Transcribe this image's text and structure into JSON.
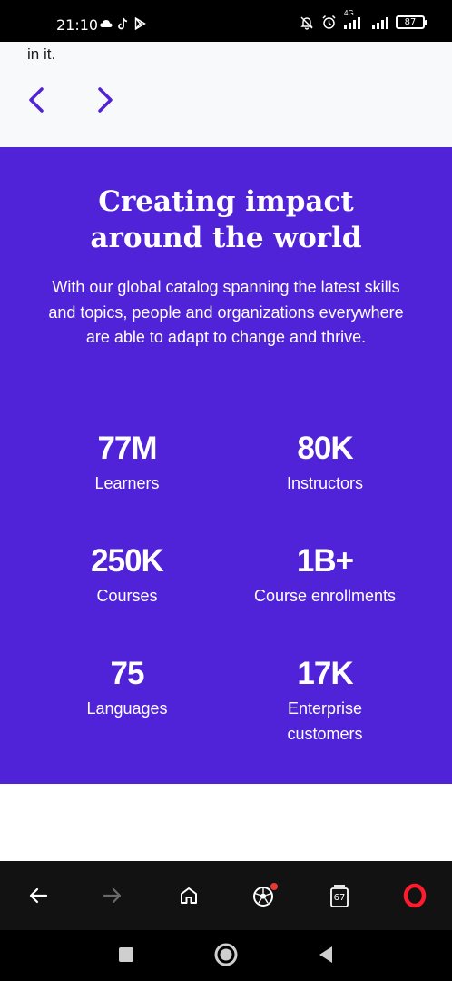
{
  "status_bar": {
    "time": "21:10",
    "network": "4G",
    "battery": "87"
  },
  "top": {
    "partial_text": "in it."
  },
  "impact": {
    "title": "Creating impact\naround the world",
    "description": "With our global catalog spanning the latest skills and topics, people and organizations everywhere are able to adapt to change and thrive.",
    "stats": [
      {
        "value": "77M",
        "label": "Learners"
      },
      {
        "value": "80K",
        "label": "Instructors"
      },
      {
        "value": "250K",
        "label": "Courses"
      },
      {
        "value": "1B+",
        "label": "Course enrollments"
      },
      {
        "value": "75",
        "label": "Languages"
      },
      {
        "value": "17K",
        "label": "Enterprise\ncustomers"
      }
    ]
  },
  "browser_bar": {
    "tab_count": "67"
  },
  "colors": {
    "brand_purple": "#5022d8",
    "arrow_purple": "#5022d8",
    "opera_red": "#ff1b2d",
    "notification_dot": "#e53935"
  },
  "icons": [
    "cloud-icon",
    "tiktok-icon",
    "play-store-icon",
    "mute-icon",
    "alarm-icon",
    "signal-icon",
    "battery-icon",
    "chevron-left-icon",
    "chevron-right-icon",
    "back-arrow-icon",
    "forward-arrow-icon",
    "home-icon",
    "football-icon",
    "tabs-icon",
    "opera-icon",
    "recent-apps-icon",
    "home-circle-icon",
    "back-triangle-icon"
  ]
}
